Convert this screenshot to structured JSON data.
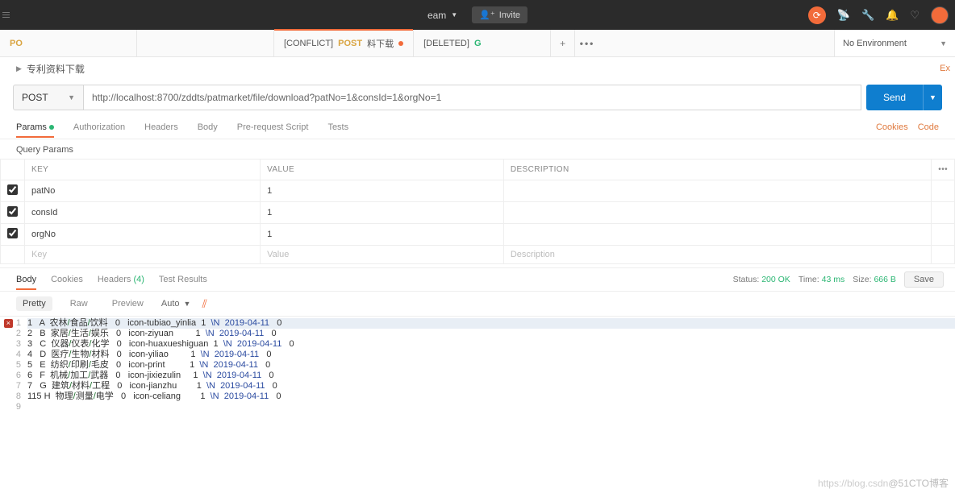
{
  "topbar": {
    "team_label": "eam",
    "invite_label": "Invite"
  },
  "tabs": {
    "t0_method": "PO",
    "t2_prefix": "[CONFLICT]",
    "t2_method": "POST",
    "t2_title": "料下载",
    "t3_prefix": "[DELETED]",
    "t3_method": "G"
  },
  "env": {
    "label": "No Environment"
  },
  "crumb": {
    "title": "专利资料下载",
    "ex": "Ex"
  },
  "request": {
    "method": "POST",
    "url": "http://localhost:8700/zddts/patmarket/file/download?patNo=1&consId=1&orgNo=1",
    "send_label": "Send"
  },
  "req_tabs": {
    "params": "Params",
    "auth": "Authorization",
    "headers": "Headers",
    "body": "Body",
    "prescript": "Pre-request Script",
    "tests": "Tests",
    "cookies_link": "Cookies",
    "code_link": "Code"
  },
  "section": {
    "query_params": "Query Params"
  },
  "ptable": {
    "h_key": "KEY",
    "h_value": "VALUE",
    "h_desc": "DESCRIPTION",
    "ph_key": "Key",
    "ph_value": "Value",
    "ph_desc": "Description",
    "rows": [
      {
        "key": "patNo",
        "value": "1"
      },
      {
        "key": "consId",
        "value": "1"
      },
      {
        "key": "orgNo",
        "value": "1"
      }
    ]
  },
  "resp_tabs": {
    "body": "Body",
    "cookies": "Cookies",
    "headers": "Headers",
    "hcount": "(4)",
    "tests": "Test Results"
  },
  "resp_meta": {
    "status_lbl": "Status:",
    "status_val": "200 OK",
    "time_lbl": "Time:",
    "time_val": "43 ms",
    "size_lbl": "Size:",
    "size_val": "666 B",
    "save": "Save"
  },
  "resp_ctrl": {
    "pretty": "Pretty",
    "raw": "Raw",
    "preview": "Preview",
    "auto": "Auto"
  },
  "body_lines": [
    {
      "n": "1",
      "c1": "1",
      "c2": "A",
      "c3": "农林/食品/饮料",
      "c4": "0",
      "c5": "icon-tubiao_yinlia",
      "c6": "1",
      "c7": "\\N",
      "c8": "2019-04-11",
      "c9": "0",
      "hl": true
    },
    {
      "n": "2",
      "c1": "2",
      "c2": "B",
      "c3": "家居/生活/娱乐",
      "c4": "0",
      "c5": "icon-ziyuan",
      "c6": "1",
      "c7": "\\N",
      "c8": "2019-04-11",
      "c9": "0"
    },
    {
      "n": "3",
      "c1": "3",
      "c2": "C",
      "c3": "仪器/仪表/化学",
      "c4": "0",
      "c5": "icon-huaxueshiguan",
      "c6": "1",
      "c7": "\\N",
      "c8": "2019-04-11",
      "c9": "0"
    },
    {
      "n": "4",
      "c1": "4",
      "c2": "D",
      "c3": "医疗/生物/材料",
      "c4": "0",
      "c5": "icon-yiliao",
      "c6": "1",
      "c7": "\\N",
      "c8": "2019-04-11",
      "c9": "0"
    },
    {
      "n": "5",
      "c1": "5",
      "c2": "E",
      "c3": "纺织/印刷/毛皮",
      "c4": "0",
      "c5": "icon-print",
      "c6": "1",
      "c7": "\\N",
      "c8": "2019-04-11",
      "c9": "0"
    },
    {
      "n": "6",
      "c1": "6",
      "c2": "F",
      "c3": "机械/加工/武器",
      "c4": "0",
      "c5": "icon-jixiezulin",
      "c6": "1",
      "c7": "\\N",
      "c8": "2019-04-11",
      "c9": "0"
    },
    {
      "n": "7",
      "c1": "7",
      "c2": "G",
      "c3": "建筑/材料/工程",
      "c4": "0",
      "c5": "icon-jianzhu",
      "c6": "1",
      "c7": "\\N",
      "c8": "2019-04-11",
      "c9": "0"
    },
    {
      "n": "8",
      "c1": "115",
      "c2": "H",
      "c3": "物理/测量/电学",
      "c4": "0",
      "c5": "icon-celiang",
      "c6": "1",
      "c7": "\\N",
      "c8": "2019-04-11",
      "c9": "0"
    },
    {
      "n": "9",
      "blank": true
    }
  ],
  "watermark": {
    "faint": "https://blog.csdn",
    "dark": "@51CTO博客"
  }
}
